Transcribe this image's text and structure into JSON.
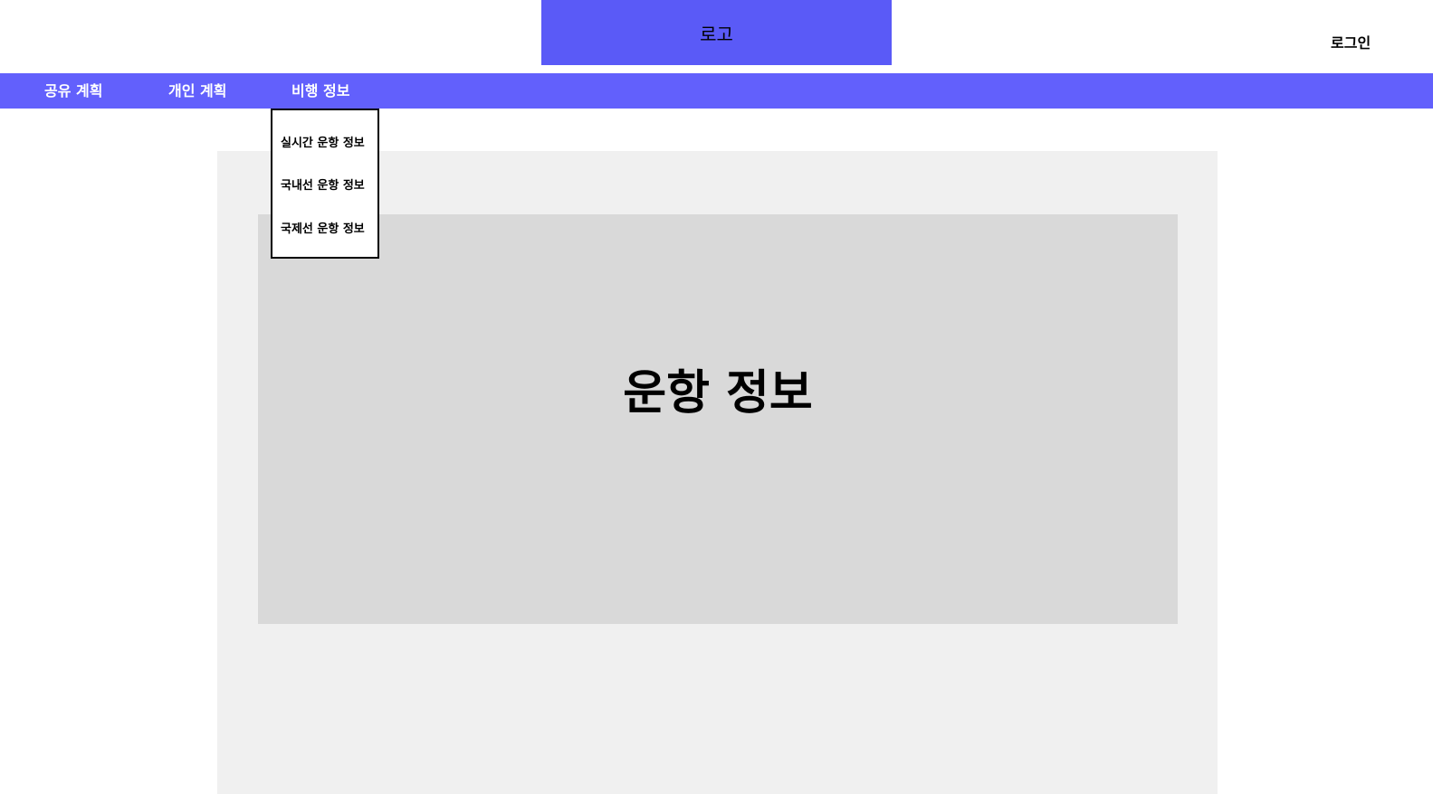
{
  "header": {
    "logo_label": "로고",
    "login_label": "로그인"
  },
  "nav": {
    "items": [
      {
        "label": "공유 계획"
      },
      {
        "label": "개인 계획"
      },
      {
        "label": "비행 정보"
      }
    ]
  },
  "dropdown": {
    "items": [
      {
        "label": "실시간 운항 정보"
      },
      {
        "label": "국내선 운항 정보"
      },
      {
        "label": "국제선 운항 정보"
      }
    ]
  },
  "main": {
    "title": "운항 정보"
  },
  "colors": {
    "logo_bg": "#5a5af7",
    "nav_bg": "#6260fc",
    "content_outer_bg": "#f0f0f0",
    "content_inner_bg": "#d9d9d9"
  }
}
